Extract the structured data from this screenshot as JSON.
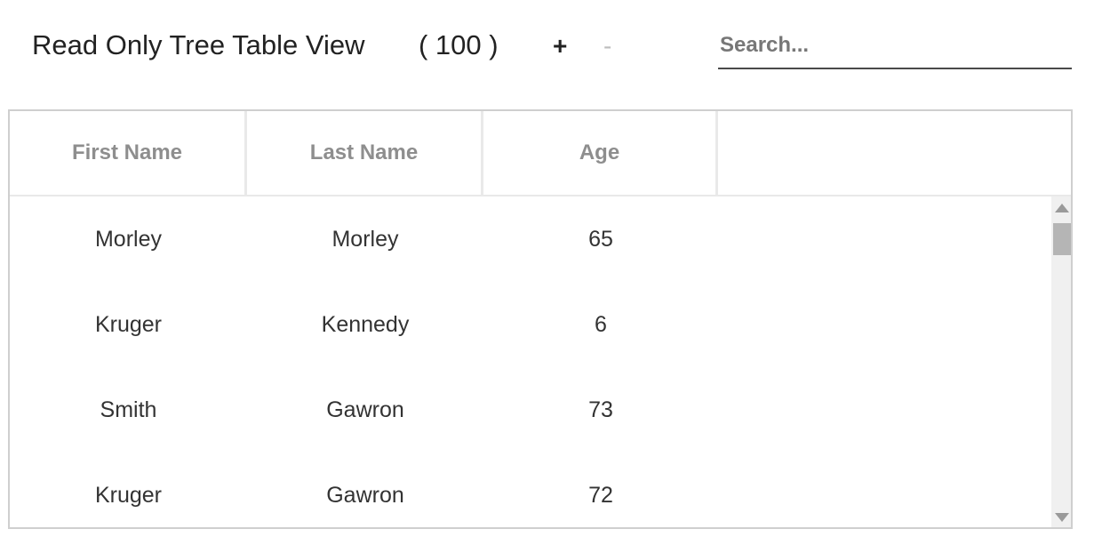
{
  "toolbar": {
    "title": "Read Only Tree Table View",
    "count": "( 100 )",
    "add_label": "+",
    "remove_label": "-",
    "search_placeholder": "Search...",
    "search_value": ""
  },
  "table": {
    "columns": [
      "First Name",
      "Last Name",
      "Age",
      ""
    ],
    "rows": [
      {
        "first_name": "Morley",
        "last_name": "Morley",
        "age": "65"
      },
      {
        "first_name": "Kruger",
        "last_name": "Kennedy",
        "age": "6"
      },
      {
        "first_name": "Smith",
        "last_name": "Gawron",
        "age": "73"
      },
      {
        "first_name": "Kruger",
        "last_name": "Gawron",
        "age": "72"
      }
    ]
  },
  "colors": {
    "header_text": "#8e8e8e",
    "border": "#cfcfcf",
    "scrollbar_track": "#f0f0f0",
    "scrollbar_thumb": "#b5b5b5"
  }
}
